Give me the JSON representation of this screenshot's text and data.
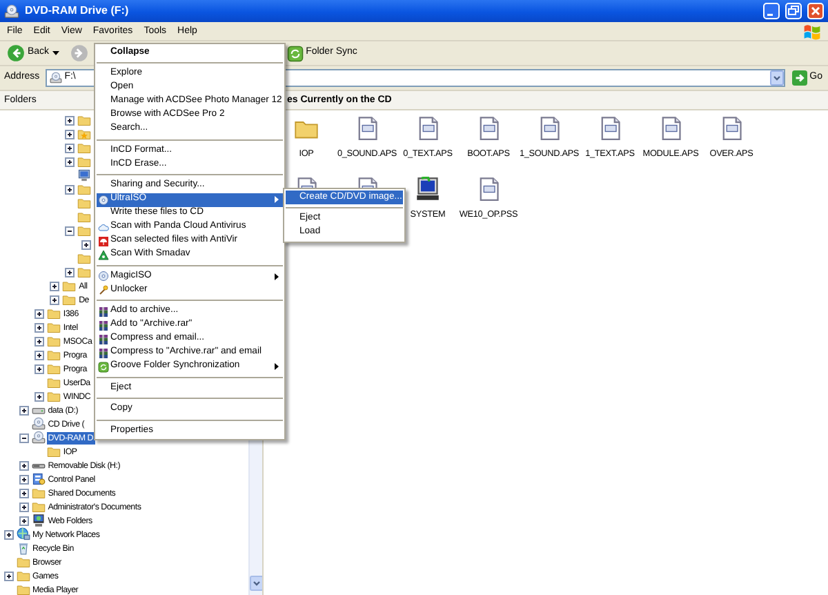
{
  "window": {
    "title": "DVD-RAM Drive (F:)"
  },
  "menu_bar": {
    "items": [
      "File",
      "Edit",
      "View",
      "Favorites",
      "Tools",
      "Help"
    ]
  },
  "toolbar": {
    "items": [
      {
        "kind": "back",
        "label": "Back",
        "disabled": false
      },
      {
        "kind": "forward",
        "disabled": true
      },
      {
        "kind": "folder_sync",
        "label": "Folder Sync"
      }
    ]
  },
  "address_bar": {
    "label": "Address",
    "value": "F:\\",
    "go_label": "Go"
  },
  "folders_pane": {
    "title": "Folders",
    "tree": [
      {
        "children": [
          {
            "children": [
              {
                "children": [
                  {
                    "children": [
                      {
                        "kind": "folder",
                        "expanded": false
                      },
                      {
                        "kind": "star-folder",
                        "expanded": false
                      },
                      {
                        "kind": "folder",
                        "expanded": false
                      },
                      {
                        "kind": "folder",
                        "expanded": false
                      },
                      {
                        "kind": "computer"
                      },
                      {
                        "kind": "folder",
                        "expanded": false
                      },
                      {
                        "kind": "folder"
                      },
                      {
                        "kind": "folder"
                      },
                      {
                        "kind": "folder",
                        "expanded": true,
                        "children": [
                          {
                            "expanded": false
                          }
                        ]
                      },
                      {
                        "kind": "folder"
                      },
                      {
                        "kind": "folder",
                        "expanded": false
                      }
                    ]
                  },
                  {
                    "label": "All",
                    "kind": "folder",
                    "expanded": false,
                    "selected": false
                  },
                  {
                    "label": "De",
                    "kind": "folder",
                    "expanded": false,
                    "selected": false
                  }
                ]
              },
              {
                "label": "I386",
                "kind": "folder",
                "expanded": false,
                "selected": false
              },
              {
                "label": "Intel",
                "kind": "folder",
                "expanded": false,
                "selected": false
              },
              {
                "label": "MSOCa",
                "kind": "folder",
                "expanded": false,
                "selected": false
              },
              {
                "label": "Progra",
                "kind": "folder",
                "expanded": false,
                "selected": false
              },
              {
                "label": "Progra",
                "kind": "folder",
                "expanded": false,
                "selected": false
              },
              {
                "label": "UserDa",
                "kind": "folder",
                "selected": false
              },
              {
                "label": "WINDC",
                "kind": "folder",
                "expanded": false,
                "selected": false
              }
            ]
          },
          {
            "label": "data (D:)",
            "kind": "drive",
            "expanded": false,
            "selected": false
          },
          {
            "label": "CD Drive (",
            "kind": "disc-drive",
            "selected": false
          },
          {
            "label": "DVD-RAM D",
            "kind": "disc-drive",
            "expanded": true,
            "selected": true,
            "children": [
              {
                "label": "IOP",
                "kind": "folder",
                "selected": false
              }
            ]
          },
          {
            "label": "Removable Disk (H:)",
            "kind": "removable",
            "expanded": false,
            "selected": false
          },
          {
            "label": "Control Panel",
            "kind": "control-panel",
            "expanded": false,
            "selected": false
          },
          {
            "label": "Shared Documents",
            "kind": "folder",
            "expanded": false,
            "selected": false
          },
          {
            "label": "Administrator's Documents",
            "kind": "folder",
            "expanded": false,
            "selected": false
          },
          {
            "label": "Web Folders",
            "kind": "monitor",
            "expanded": false,
            "selected": false
          }
        ]
      },
      {
        "label": "My Network Places",
        "kind": "network",
        "expanded": false,
        "selected": false
      },
      {
        "label": "Recycle Bin",
        "kind": "recycle",
        "selected": false
      },
      {
        "label": "Browser",
        "kind": "folder",
        "selected": false
      },
      {
        "label": "Games",
        "kind": "folder",
        "expanded": false,
        "selected": false
      },
      {
        "label": "Media Player",
        "kind": "folder",
        "selected": false
      }
    ]
  },
  "content": {
    "heading": "es Currently on the CD",
    "files": [
      {
        "kind": "folder",
        "name": "IOP"
      },
      {
        "kind": "file",
        "name": "0_SOUND.APS"
      },
      {
        "kind": "file",
        "name": "0_TEXT.APS"
      },
      {
        "kind": "file",
        "name": "BOOT.APS"
      },
      {
        "kind": "file",
        "name": "1_SOUND.APS"
      },
      {
        "kind": "file",
        "name": "1_TEXT.APS"
      },
      {
        "kind": "file",
        "name": "MODULE.APS"
      },
      {
        "kind": "file",
        "name": "OVER.APS"
      },
      {
        "kind": "file"
      },
      {
        "kind": "file"
      },
      {
        "kind": "system",
        "name": "SYSTEM"
      },
      {
        "kind": "file",
        "name": "WE10_OP.PSS"
      }
    ]
  },
  "context_menu": {
    "items": [
      {
        "kind": "plain",
        "label": "Collapse",
        "bold": true,
        "selected": false
      },
      {
        "kind": "separator"
      },
      {
        "kind": "plain",
        "label": "Explore",
        "selected": false
      },
      {
        "kind": "plain",
        "label": "Open",
        "selected": false
      },
      {
        "kind": "plain",
        "label": "Manage with ACDSee Photo Manager 12",
        "selected": false
      },
      {
        "kind": "plain",
        "label": "Browse with ACDSee Pro 2",
        "selected": false
      },
      {
        "kind": "plain",
        "label": "Search...",
        "selected": false
      },
      {
        "kind": "separator"
      },
      {
        "kind": "plain",
        "label": "InCD Format...",
        "selected": false
      },
      {
        "kind": "plain",
        "label": "InCD Erase...",
        "selected": false
      },
      {
        "kind": "separator"
      },
      {
        "kind": "plain",
        "label": "Sharing and Security...",
        "selected": false
      },
      {
        "kind": "disc",
        "label": "UltraISO",
        "submenu": true,
        "selected": true
      },
      {
        "kind": "plain",
        "label": "Write these files to CD",
        "selected": false
      },
      {
        "kind": "cloud",
        "label": "Scan with Panda Cloud Antivirus",
        "selected": false
      },
      {
        "kind": "umbrella",
        "label": "Scan selected files with AntiVir",
        "selected": false
      },
      {
        "kind": "triangle",
        "label": "Scan With Smadav",
        "selected": false
      },
      {
        "kind": "separator"
      },
      {
        "kind": "disc",
        "label": "MagicISO",
        "submenu": true,
        "selected": false
      },
      {
        "kind": "wand",
        "label": "Unlocker",
        "selected": false
      },
      {
        "kind": "separator"
      },
      {
        "kind": "books",
        "label": "Add to archive...",
        "selected": false
      },
      {
        "kind": "books",
        "label": "Add to \"Archive.rar\"",
        "selected": false
      },
      {
        "kind": "books",
        "label": "Compress and email...",
        "selected": false
      },
      {
        "kind": "books",
        "label": "Compress to \"Archive.rar\" and email",
        "selected": false
      },
      {
        "kind": "sync",
        "label": "Groove Folder Synchronization",
        "submenu": true,
        "selected": false
      },
      {
        "kind": "separator"
      },
      {
        "kind": "plain",
        "label": "Eject",
        "selected": false
      },
      {
        "kind": "separator"
      },
      {
        "kind": "plain",
        "label": "Copy",
        "selected": false
      },
      {
        "kind": "separator"
      },
      {
        "kind": "plain",
        "label": "Properties",
        "selected": false
      }
    ]
  },
  "submenu": {
    "items": [
      {
        "kind": "plain",
        "label": "Create CD/DVD image...",
        "selected": true
      },
      {
        "kind": "separator"
      },
      {
        "kind": "plain",
        "label": "Eject",
        "selected": false
      },
      {
        "kind": "plain",
        "label": "Load",
        "selected": false
      }
    ]
  }
}
